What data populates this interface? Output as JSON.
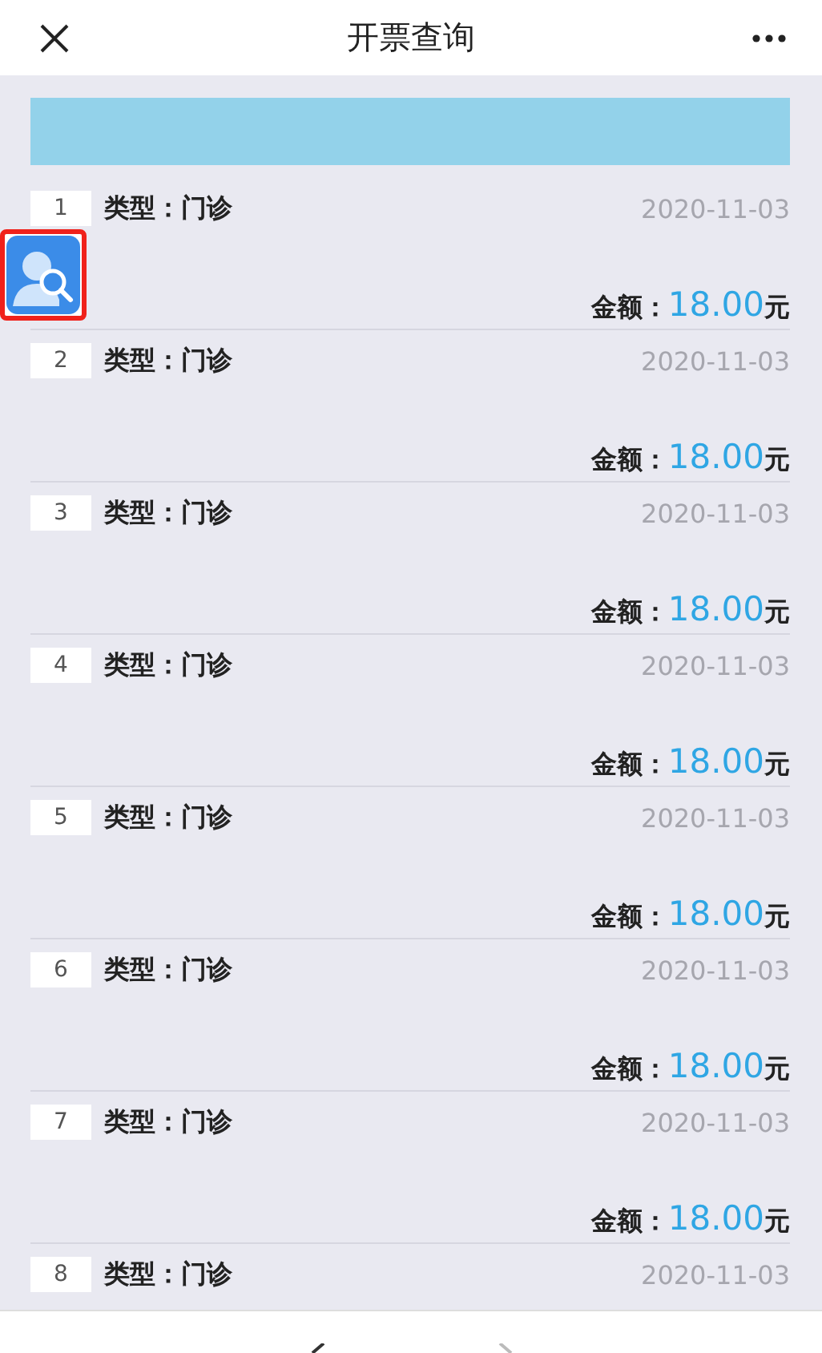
{
  "header": {
    "title": "开票查询"
  },
  "items": [
    {
      "index": "1",
      "type": "类型：门诊",
      "date": "2020-11-03",
      "amount_label": "金额：",
      "amount": "18.00",
      "unit": "元"
    },
    {
      "index": "2",
      "type": "类型：门诊",
      "date": "2020-11-03",
      "amount_label": "金额：",
      "amount": "18.00",
      "unit": "元"
    },
    {
      "index": "3",
      "type": "类型：门诊",
      "date": "2020-11-03",
      "amount_label": "金额：",
      "amount": "18.00",
      "unit": "元"
    },
    {
      "index": "4",
      "type": "类型：门诊",
      "date": "2020-11-03",
      "amount_label": "金额：",
      "amount": "18.00",
      "unit": "元"
    },
    {
      "index": "5",
      "type": "类型：门诊",
      "date": "2020-11-03",
      "amount_label": "金额：",
      "amount": "18.00",
      "unit": "元"
    },
    {
      "index": "6",
      "type": "类型：门诊",
      "date": "2020-11-03",
      "amount_label": "金额：",
      "amount": "18.00",
      "unit": "元"
    },
    {
      "index": "7",
      "type": "类型：门诊",
      "date": "2020-11-03",
      "amount_label": "金额：",
      "amount": "18.00",
      "unit": "元"
    },
    {
      "index": "8",
      "type": "类型：门诊",
      "date": "2020-11-03"
    }
  ]
}
